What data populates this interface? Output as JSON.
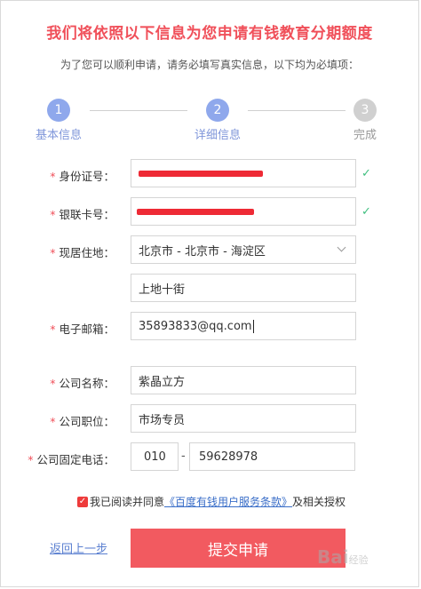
{
  "header": {
    "title": "我们将依照以下信息为您申请有钱教育分期额度",
    "subtitle": "为了您可以顺利申请，请务必填写真实信息，以下均为必填项："
  },
  "steps": [
    {
      "number": "1",
      "label": "基本信息",
      "state": "active"
    },
    {
      "number": "2",
      "label": "详细信息",
      "state": "active"
    },
    {
      "number": "3",
      "label": "完成",
      "state": "inactive"
    }
  ],
  "form": {
    "required_mark": "*",
    "id_card": {
      "label": "身份证号：",
      "check": "✓"
    },
    "bank_card": {
      "label": "银联卡号：",
      "check": "✓"
    },
    "address": {
      "label": "现居住地：",
      "region": "北京市 - 北京市 - 海淀区",
      "street": "上地十街"
    },
    "email": {
      "label": "电子邮箱：",
      "value": "35893833@qq.com"
    },
    "company_name": {
      "label": "公司名称：",
      "value": "紫晶立方"
    },
    "position": {
      "label": "公司职位：",
      "value": "市场专员"
    },
    "company_phone": {
      "label": "公司固定电话：",
      "area_code": "010",
      "separator": "-",
      "number": "59628978"
    }
  },
  "agreement": {
    "checked": true,
    "checkmark": "✓",
    "prefix": "我已阅读并同意",
    "link": "《百度有钱用户服务条款》",
    "suffix": "及相关授权"
  },
  "actions": {
    "back_label": "返回上一步",
    "submit_label": "提交申请"
  },
  "watermark": {
    "text": "Bai",
    "sub": "经验"
  },
  "colors": {
    "accent": "#f0505a",
    "step_active": "#8fa8ec",
    "step_inactive": "#d0d0d0",
    "check": "#3fbf7f",
    "link": "#3a6ec8"
  }
}
